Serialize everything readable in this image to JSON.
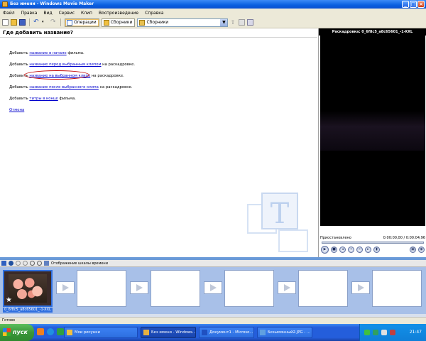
{
  "window": {
    "title": "Без имени - Windows Movie Maker",
    "buttons": {
      "minimize": "_",
      "maximize": "□",
      "close": "×"
    }
  },
  "menu": [
    "Файл",
    "Правка",
    "Вид",
    "Сервис",
    "Клип",
    "Воспроизведение",
    "Справка"
  ],
  "toolbar": {
    "tasks_label": "Операции",
    "collections_label": "Сборники",
    "collection_combo": "Сборники"
  },
  "task_pane": {
    "title": "Где добавить название?",
    "lines": [
      {
        "pre": "Добавить ",
        "link": "название в начале",
        "post": " фильма."
      },
      {
        "pre": "Добавить ",
        "link": "название перед выбранным клипом",
        "post": " на раскадровке."
      },
      {
        "pre": "Добавить ",
        "link": "название на выбранном клипе",
        "post": " на раскадровке."
      },
      {
        "pre": "Добавить ",
        "link": "название после выбранного клипа",
        "post": " на раскадровке."
      },
      {
        "pre": "Добавить ",
        "link": "титры в конце",
        "post": " фильма."
      }
    ],
    "cancel": "Отмена",
    "colors": {
      "link": "#0000cc",
      "highlight_ring": "#c00000"
    }
  },
  "preview": {
    "title": "Раскадровка: 0_6f8c5_a8c65601_-1-XXL",
    "status": "Приостановлено",
    "time": "0:00:00,00 / 0:00:04,96"
  },
  "storyboard": {
    "toolbar_label": "Отображение шкалы времени",
    "first_clip_caption": "0_6f8c5_a8c65601_-1-XXL",
    "empty_cells": 5
  },
  "status_bar": "Готово",
  "taskbar": {
    "start": "пуск",
    "buttons": [
      {
        "label": "Мои рисунки",
        "active": false
      },
      {
        "label": "Без имени - Windows...",
        "active": true
      },
      {
        "label": "Документ1 - Microso...",
        "active": false
      },
      {
        "label": "Безымянный2.JPG - ...",
        "active": false
      }
    ],
    "clock": "21:47"
  }
}
